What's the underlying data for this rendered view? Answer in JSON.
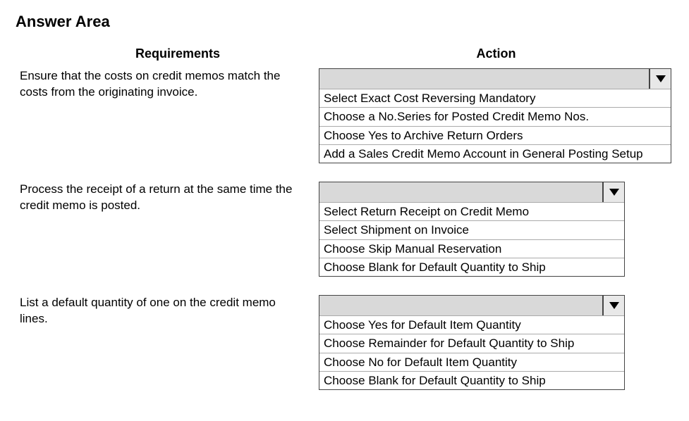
{
  "title": "Answer Area",
  "headers": {
    "requirements": "Requirements",
    "action": "Action"
  },
  "rows": [
    {
      "requirement": "Ensure that the costs on credit memos match the costs from the originating invoice.",
      "options": [
        "Select Exact Cost Reversing Mandatory",
        "Choose a No.Series for Posted Credit Memo Nos.",
        "Choose Yes to Archive Return Orders",
        "Add a Sales Credit Memo Account in General Posting Setup"
      ]
    },
    {
      "requirement": "Process the receipt of a return at the same time the credit memo is posted.",
      "options": [
        "Select Return Receipt on Credit Memo",
        "Select Shipment on Invoice",
        "Choose Skip Manual Reservation",
        "Choose Blank for Default Quantity to Ship"
      ]
    },
    {
      "requirement": "List a default quantity of one on the credit memo lines.",
      "options": [
        "Choose Yes for Default Item Quantity",
        "Choose Remainder for Default Quantity to Ship",
        "Choose No for Default Item Quantity",
        "Choose Blank for Default Quantity to Ship"
      ]
    }
  ]
}
